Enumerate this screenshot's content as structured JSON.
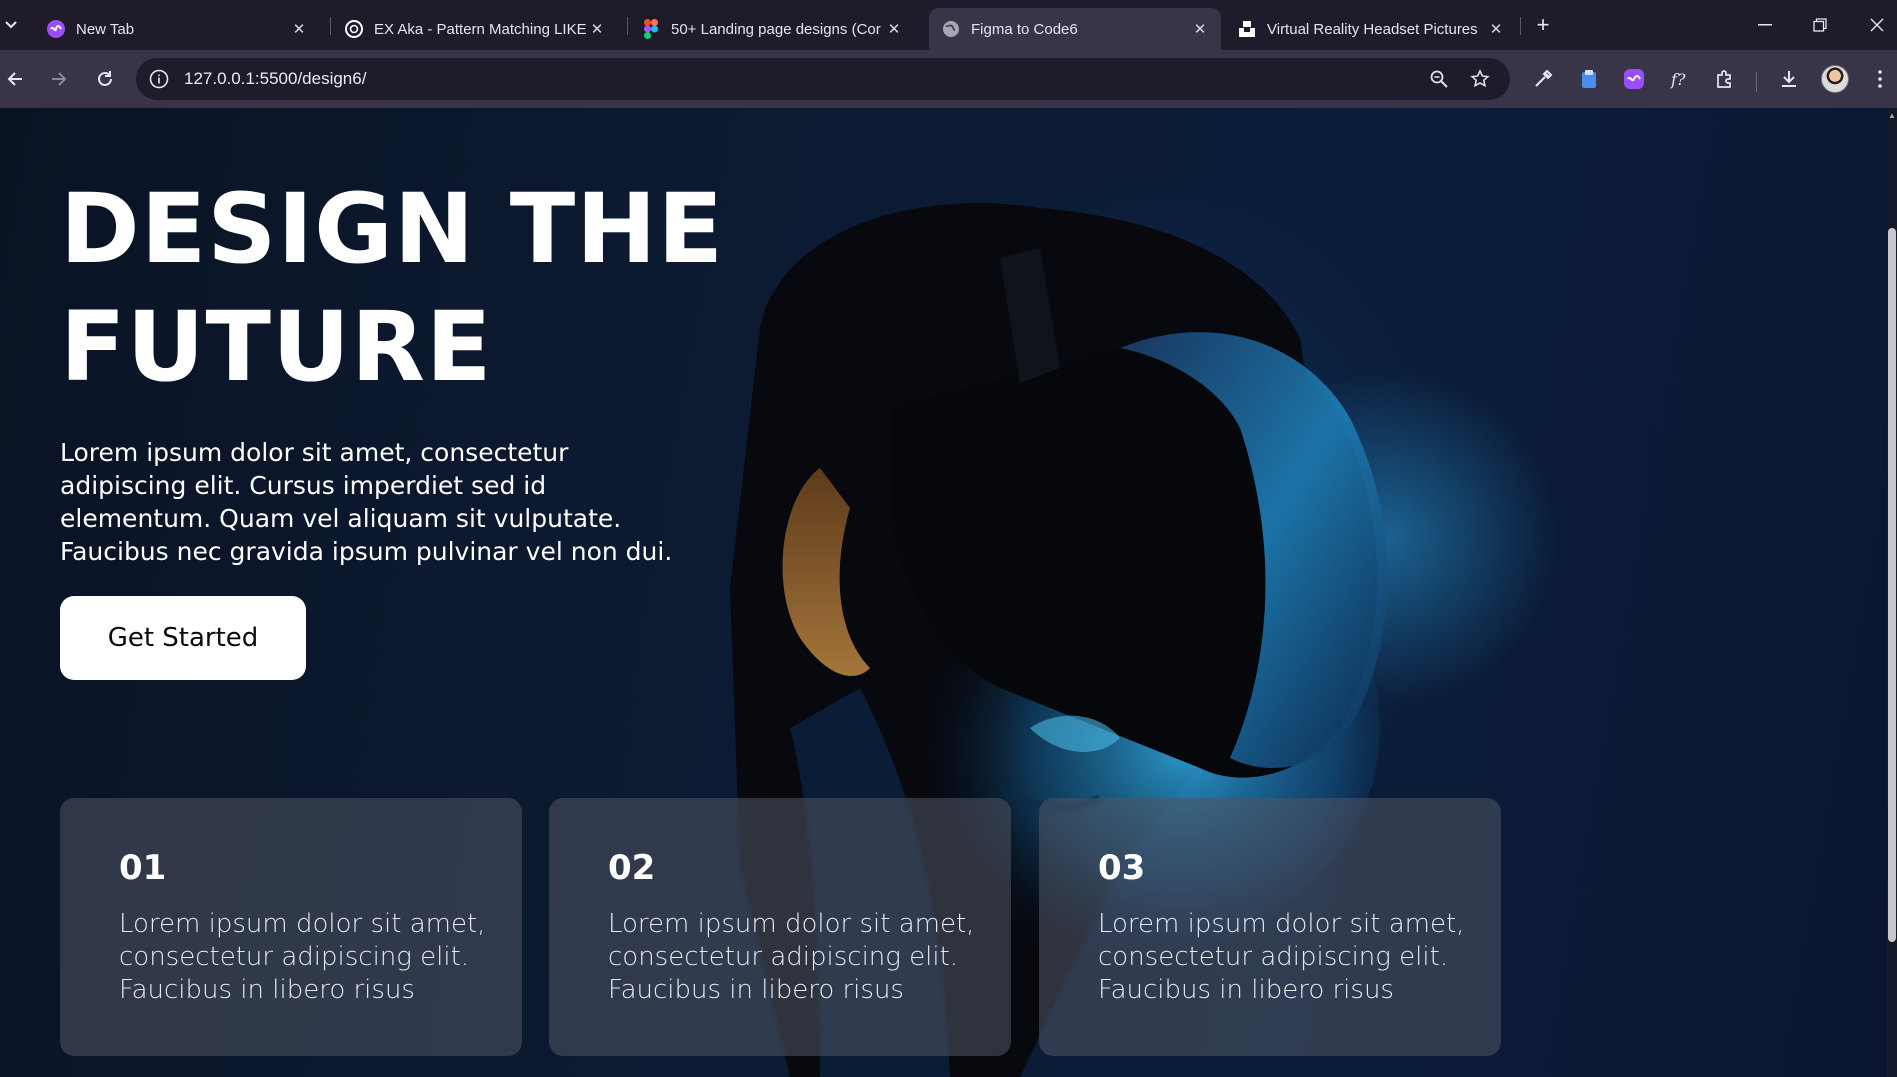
{
  "browser": {
    "tabs": [
      {
        "title": "New Tab",
        "icon": "purple-ai-icon"
      },
      {
        "title": "EX Aka - Pattern Matching LIKE",
        "icon": "openai-icon"
      },
      {
        "title": "50+ Landing page designs (Cor",
        "icon": "figma-icon"
      },
      {
        "title": "Figma to Code6",
        "icon": "globe-icon",
        "active": true
      },
      {
        "title": "Virtual Reality Headset Pictures",
        "icon": "unsplash-icon"
      }
    ],
    "url": "127.0.0.1:5500/design6/"
  },
  "hero": {
    "title_line1": "DESIGN THE",
    "title_line2": "FUTURE",
    "description": "Lorem ipsum dolor sit amet, consectetur adipiscing elit. Cursus imperdiet sed id elementum. Quam vel aliquam sit vulputate. Faucibus nec gravida ipsum pulvinar vel non dui.",
    "cta_label": "Get Started"
  },
  "cards": [
    {
      "number": "01",
      "text": "Lorem ipsum dolor sit amet, consectetur adipiscing elit. Faucibus in libero risus"
    },
    {
      "number": "02",
      "text": "Lorem ipsum dolor sit amet, consectetur adipiscing elit. Faucibus in libero risus"
    },
    {
      "number": "03",
      "text": "Lorem ipsum dolor sit amet, consectetur adipiscing elit. Faucibus in libero risus"
    }
  ],
  "colors": {
    "tabbar_bg": "#1f1b2b",
    "toolbar_bg": "#3a3448",
    "page_bg": "#0b1426",
    "accent_cyan": "#2aa3d8",
    "button_bg": "#ffffff"
  }
}
